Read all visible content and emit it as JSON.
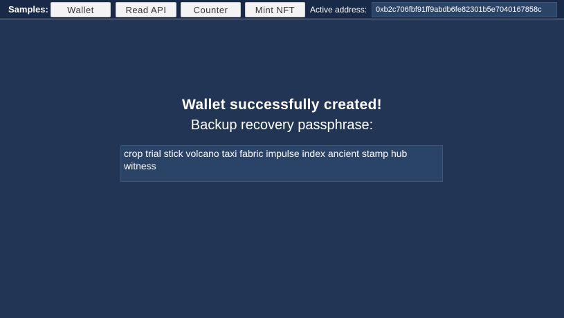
{
  "toolbar": {
    "samples_label": "Samples:",
    "buttons": [
      {
        "label": "Wallet"
      },
      {
        "label": "Read API"
      },
      {
        "label": "Counter"
      },
      {
        "label": "Mint NFT"
      }
    ],
    "active_address_label": "Active address:",
    "active_address_value": "0xb2c706fbf91ff9abdb6fe82301b5e7040167858c"
  },
  "main": {
    "title": "Wallet successfully created!",
    "subtitle": "Backup recovery passphrase:",
    "passphrase": "crop trial stick volcano taxi fabric impulse index ancient stamp hub witness"
  },
  "colors": {
    "background": "#233554",
    "topbar": "#192a48",
    "field": "#2a4468",
    "button": "#f3f3f3"
  }
}
